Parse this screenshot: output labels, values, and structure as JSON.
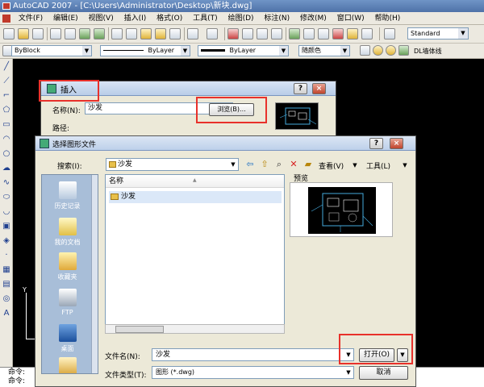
{
  "window": {
    "title": "AutoCAD 2007 - [C:\\Users\\Administrator\\Desktop\\新块.dwg]"
  },
  "menu": [
    "文件(F)",
    "编辑(E)",
    "视图(V)",
    "插入(I)",
    "格式(O)",
    "工具(T)",
    "绘图(D)",
    "标注(N)",
    "修改(M)",
    "窗口(W)",
    "帮助(H)"
  ],
  "toolbar": {
    "text_style": "Standard"
  },
  "properties": {
    "layer": "ByBlock",
    "linetype": "ByLayer",
    "lineweight": "ByLayer",
    "color": "随颜色",
    "layer_extra": "DL墙体线"
  },
  "ucs": {
    "y_label": "Y"
  },
  "command_lines": [
    "命令:",
    "命令:"
  ],
  "insert_dialog": {
    "title": "插入",
    "name_label": "名称(N):",
    "name_value": "沙发",
    "browse_button": "浏览(B)...",
    "path_label": "路径:"
  },
  "select_dialog": {
    "title": "选择图形文件",
    "search_label": "搜索(I):",
    "current_folder": "沙发",
    "view_label": "查看(V)",
    "tools_label": "工具(L)",
    "places": [
      "历史记录",
      "我的文档",
      "收藏夹",
      "FTP",
      "桌面"
    ],
    "column_name": "名称",
    "files": [
      {
        "name": "沙发"
      }
    ],
    "preview_label": "预览",
    "filename_label": "文件名(N):",
    "filename_value": "沙发",
    "filetype_label": "文件类型(T):",
    "filetype_value": "图形 (*.dwg)",
    "open_button": "打开(O)",
    "cancel_button": "取消"
  },
  "colors": {
    "highlight": "#e8312b",
    "canvas": "#000000",
    "dialog_bg": "#ece9d8",
    "places_bg": "#a8bed8"
  }
}
